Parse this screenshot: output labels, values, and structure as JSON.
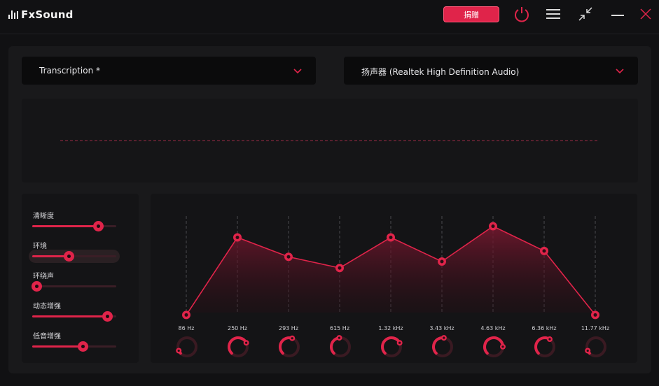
{
  "app": {
    "title": "FxSound",
    "donate_label": "捐赠",
    "accent": "#e0244a"
  },
  "titlebar_icons": [
    "power-icon",
    "menu-icon",
    "minimize-view-icon",
    "minimize-icon",
    "close-icon"
  ],
  "preset": {
    "value": "Transcription *"
  },
  "output_device": {
    "value": "扬声器 (Realtek High Definition Audio)"
  },
  "effects": [
    {
      "label": "清晰度",
      "value": 0.8
    },
    {
      "label": "环境",
      "value": 0.42
    },
    {
      "label": "环绕声",
      "value": 0.0
    },
    {
      "label": "动态增强",
      "value": 0.92
    },
    {
      "label": "低音增强",
      "value": 0.6
    }
  ],
  "eq_bands": [
    {
      "freq": "86 Hz",
      "gain": -0.85
    },
    {
      "freq": "250 Hz",
      "gain": 0.47
    },
    {
      "freq": "293 Hz",
      "gain": 0.14
    },
    {
      "freq": "615 Hz",
      "gain": -0.05
    },
    {
      "freq": "1.32 kHz",
      "gain": 0.47
    },
    {
      "freq": "3.43 kHz",
      "gain": 0.06
    },
    {
      "freq": "4.63 kHz",
      "gain": 0.66
    },
    {
      "freq": "6.36 kHz",
      "gain": 0.24
    },
    {
      "freq": "11.77 kHz",
      "gain": -0.85
    }
  ]
}
